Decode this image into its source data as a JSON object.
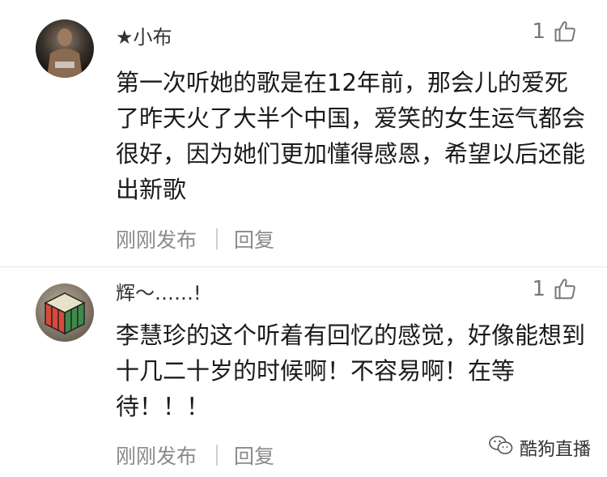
{
  "comments": [
    {
      "username": "★小布",
      "likes": "1",
      "content": "第一次听她的歌是在12年前，那会儿的爱死了昨天火了大半个中国，爱笑的女生运气都会很好，因为她们更加懂得感恩，希望以后还能出新歌",
      "time": "刚刚发布",
      "reply": "回复",
      "avatar_icon": "wrestler-avatar"
    },
    {
      "username": "辉～……!",
      "likes": "1",
      "content": "李慧珍的这个听着有回忆的感觉，好像能想到十几二十岁的时候啊！不容易啊！在等待！！！",
      "time": "刚刚发布",
      "reply": "回复",
      "avatar_icon": "rubiks-cube-avatar"
    }
  ],
  "watermark": {
    "text": "酷狗直播",
    "icon": "wechat-icon"
  }
}
